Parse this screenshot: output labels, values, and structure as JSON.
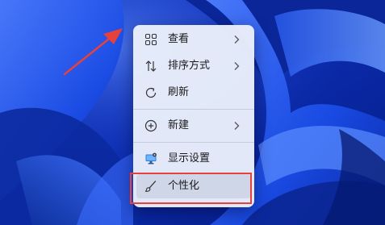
{
  "menu": {
    "items": [
      {
        "label": "查看",
        "icon": "grid-icon",
        "has_submenu": true
      },
      {
        "label": "排序方式",
        "icon": "sort-icon",
        "has_submenu": true
      },
      {
        "label": "刷新",
        "icon": "refresh-icon",
        "has_submenu": false
      },
      {
        "label": "新建",
        "icon": "add-circle-icon",
        "has_submenu": true
      },
      {
        "label": "显示设置",
        "icon": "display-settings-icon",
        "has_submenu": false
      },
      {
        "label": "个性化",
        "icon": "brush-icon",
        "has_submenu": false
      }
    ]
  },
  "annotation": {
    "highlight_color": "#e8403a",
    "arrow_color": "#e8403a"
  },
  "colors": {
    "wallpaper_base": "#0a2fb8",
    "menu_background": "#e9eefa",
    "text": "#1a1a1a"
  }
}
